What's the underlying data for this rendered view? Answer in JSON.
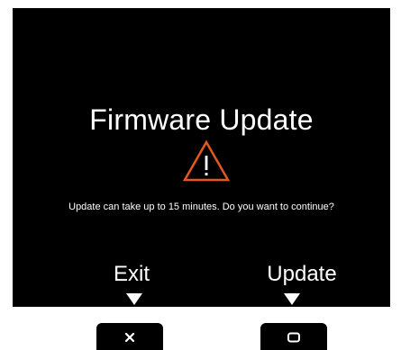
{
  "dialog": {
    "title": "Firmware Update",
    "warning_icon": "warning-triangle-icon",
    "warning_color": "#e4571e",
    "message": "Update can take up to 15 minutes. Do you want to continue?"
  },
  "softkeys": {
    "exit_label": "Exit",
    "update_label": "Update",
    "exit_icon": "close-icon",
    "update_icon": "rounded-square-icon"
  }
}
